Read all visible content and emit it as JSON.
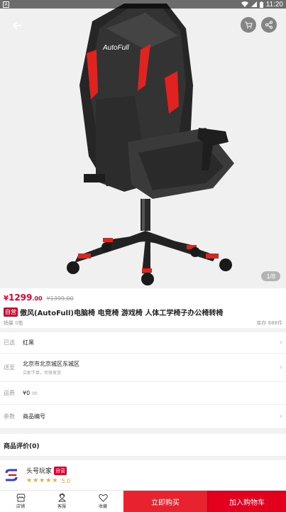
{
  "status_bar": {
    "time": "11:20",
    "notification_glyph": "A"
  },
  "hero": {
    "image_counter": "1/8",
    "brand_on_chair": "AutoFull"
  },
  "product": {
    "currency": "¥",
    "price": "1299",
    "price_cents": ".00",
    "original_price": "¥1399.00",
    "self_op_badge": "自营",
    "title": "傲风(AutoFull)电脑椅 电竞椅 游戏椅 人体工学椅子办公椅转椅",
    "sales": "销量 0笔",
    "stock": "库存 888件"
  },
  "options": {
    "selected": {
      "label": "已选",
      "value": "红黑"
    },
    "ship_to": {
      "label": "送至",
      "value": "北京市北京城区东城区",
      "note": "立即下单，尽快发货"
    },
    "freight": {
      "label": "运费",
      "value": "¥0",
      "cents": ".00"
    },
    "params": {
      "label": "参数",
      "value": "商品编号"
    }
  },
  "reviews": {
    "title": "商品评价(0)"
  },
  "shop": {
    "name": "头号玩家",
    "badge": "自营",
    "rating": "5.0",
    "stars": 5
  },
  "bottom_bar": {
    "store_label": "店铺",
    "service_label": "客服",
    "favorite_label": "收藏",
    "buy_now_label": "立即购买",
    "add_cart_label": "加入购物车"
  },
  "colors": {
    "accent": "#e4002b",
    "star": "#f5a623"
  }
}
